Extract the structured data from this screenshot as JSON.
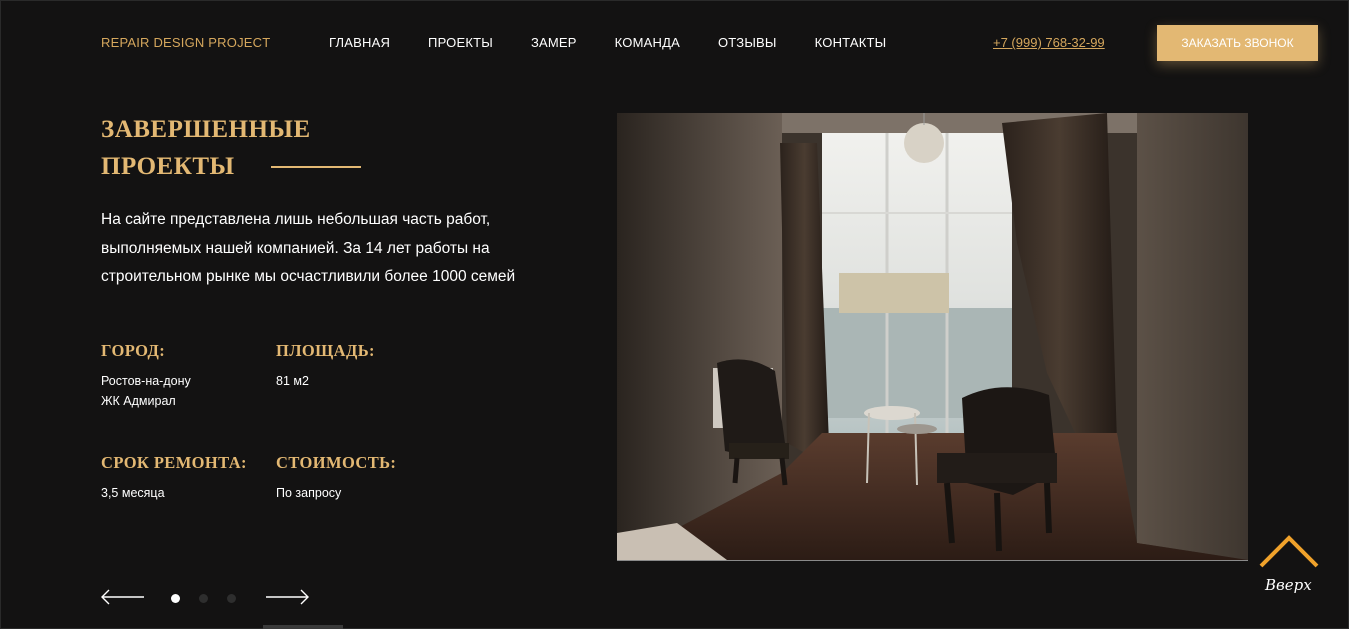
{
  "header": {
    "logo": "REPAIR DESIGN PROJECT",
    "nav": [
      "ГЛАВНАЯ",
      "ПРОЕКТЫ",
      "ЗАМЕР",
      "КОМАНДА",
      "ОТЗЫВЫ",
      "КОНТАКТЫ"
    ],
    "phone": "+7 (999) 768-32-99",
    "call_button": "ЗАКАЗАТЬ ЗВОНОК"
  },
  "section": {
    "title_line1": "ЗАВЕРШЕННЫЕ",
    "title_line2": "ПРОЕКТЫ",
    "description": "На сайте представлена лишь небольшая часть работ, выполняемых нашей компанией. За 14 лет работы на строительном рынке мы осчастливили более 1000 семей"
  },
  "project": {
    "city_label": "ГОРОД:",
    "city_value": "Ростов-на-дону\nЖК Адмирал",
    "area_label": "ПЛОЩАДЬ:",
    "area_value": "81 м2",
    "duration_label": "СРОК РЕМОНТА:",
    "duration_value": "3,5 месяца",
    "cost_label": "СТОИМОСТЬ:",
    "cost_value": "По запросу"
  },
  "slider": {
    "active_index": 0,
    "dot_count": 3
  },
  "scroll_top": {
    "label": "Вверх"
  },
  "colors": {
    "background": "#131212",
    "accent": "#e3b873",
    "text": "#ffffff"
  },
  "icons": {
    "prev": "arrow-left-icon",
    "next": "arrow-right-icon",
    "up": "chevron-up-icon"
  }
}
